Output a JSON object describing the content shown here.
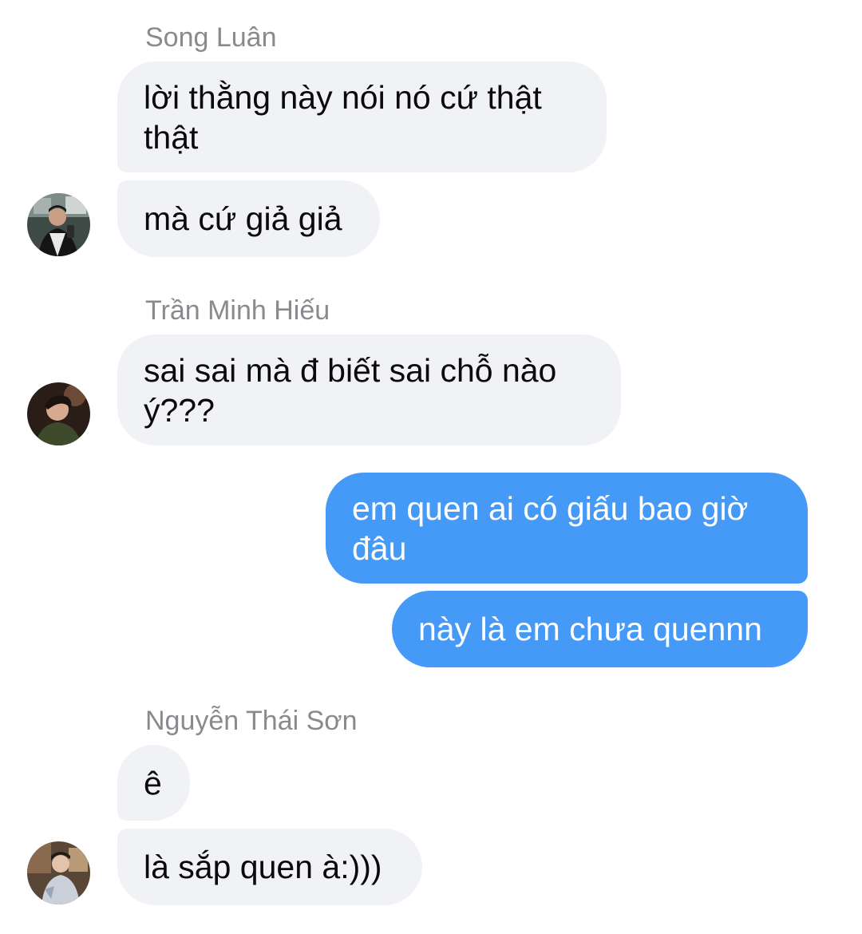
{
  "colors": {
    "incoming_bubble": "#f1f2f6",
    "outgoing_bubble": "#4599f7",
    "sender_name": "#8a8a8e"
  },
  "groups": [
    {
      "sender": "Song Luân",
      "avatar_icon": "person-avatar-icon",
      "messages": [
        "lời thằng này nói nó cứ thật\nthật",
        "mà cứ giả giả"
      ]
    },
    {
      "sender": "Trần Minh Hiếu",
      "avatar_icon": "person-avatar-icon",
      "messages": [
        "sai sai mà đ biết sai chỗ nào\ný???"
      ]
    },
    {
      "sender": "",
      "outgoing": true,
      "messages": [
        "em quen ai có giấu bao giờ\nđâu",
        "này là em chưa quennn"
      ]
    },
    {
      "sender": "Nguyễn Thái Sơn",
      "avatar_icon": "person-avatar-icon",
      "messages": [
        "ê",
        "là sắp quen à:)))"
      ]
    }
  ]
}
